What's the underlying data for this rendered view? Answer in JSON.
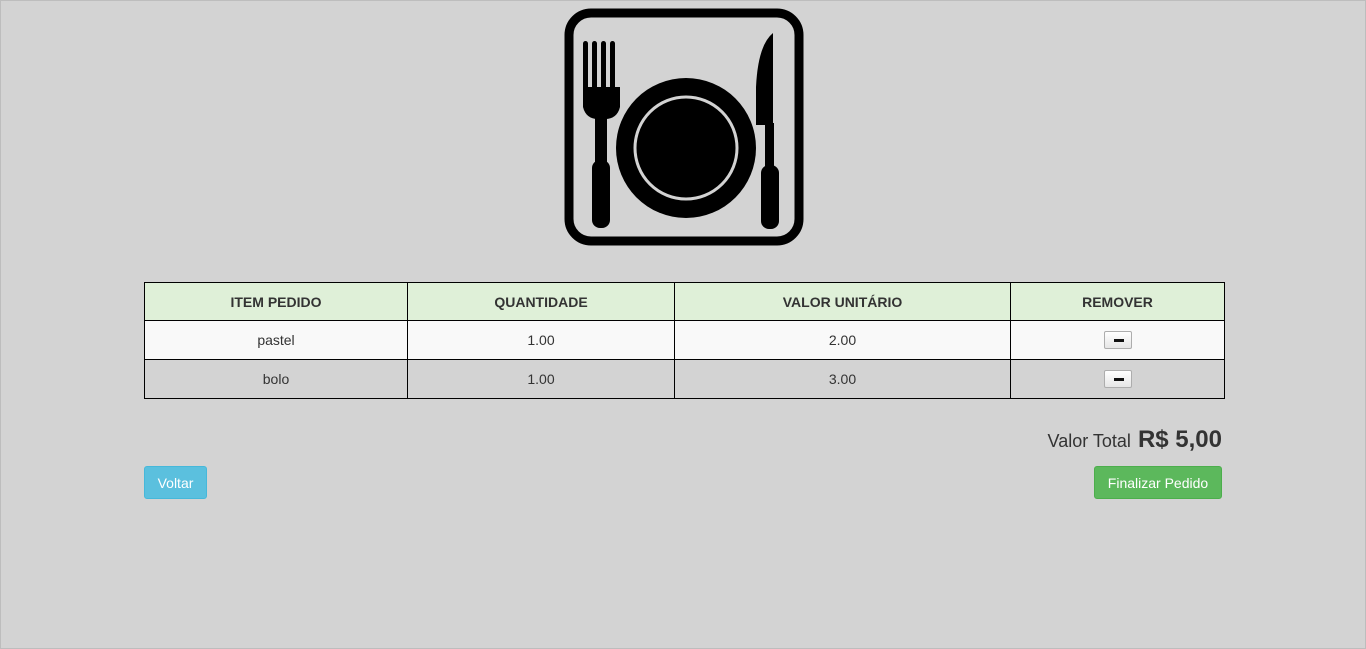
{
  "logo": {
    "icon": "plate-fork-knife-icon"
  },
  "table": {
    "headers": [
      "ITEM PEDIDO",
      "QUANTIDADE",
      "VALOR UNITÁRIO",
      "REMOVER"
    ],
    "rows": [
      {
        "item": "pastel",
        "quantity": "1.00",
        "unit_price": "2.00",
        "remove_icon": "minus-icon"
      },
      {
        "item": "bolo",
        "quantity": "1.00",
        "unit_price": "3.00",
        "remove_icon": "minus-icon"
      }
    ]
  },
  "summary": {
    "label": "Valor Total",
    "amount": "R$ 5,00"
  },
  "actions": {
    "back_label": "Voltar",
    "finish_label": "Finalizar Pedido"
  },
  "colors": {
    "background": "#d3d3d3",
    "header_bg": "#dff0d8",
    "back_button": "#5bc0de",
    "finish_button": "#5cb85c"
  }
}
